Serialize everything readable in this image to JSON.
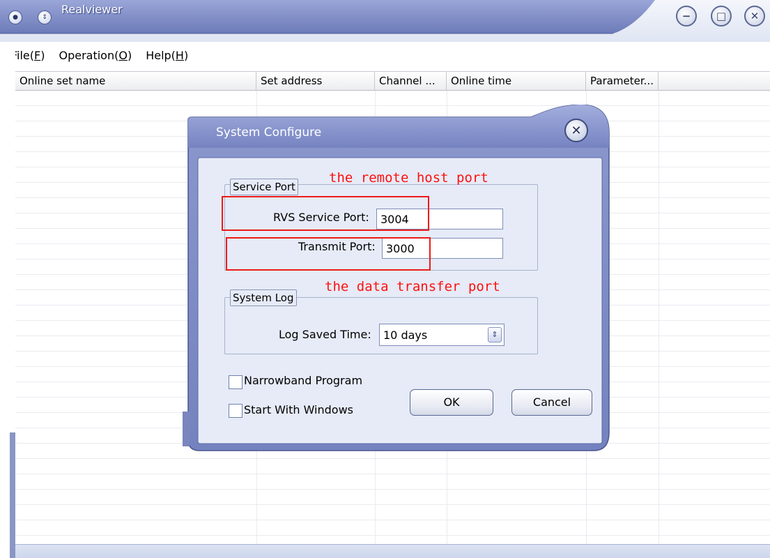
{
  "window": {
    "title": "Realviewer",
    "controls": {
      "minimize": "−",
      "maximize": "□",
      "close": "✕"
    }
  },
  "menu": [
    {
      "label": "File(",
      "key": "F",
      "suffix": ")"
    },
    {
      "label": "Operation(",
      "key": "O",
      "suffix": ")"
    },
    {
      "label": "Help(",
      "key": "H",
      "suffix": ")"
    }
  ],
  "list": {
    "columns": [
      "Online set name",
      "Set address",
      "Channel ...",
      "Online time",
      "Parameter..."
    ]
  },
  "dialog": {
    "title": "System Configure",
    "close": "✕",
    "service_port": {
      "label": "Service Port",
      "rvs_label": "RVS Service Port:",
      "rvs_value": "3004",
      "transmit_label": "Transmit Port:",
      "transmit_value": "3000"
    },
    "system_log": {
      "label": "System Log",
      "saved_time_label": "Log Saved Time:",
      "saved_time_value": "10 days"
    },
    "options": {
      "narrowband": "Narrowband Program",
      "start_with_windows": "Start With Windows"
    },
    "buttons": {
      "ok": "OK",
      "cancel": "Cancel"
    }
  },
  "annotations": {
    "remote_host": "the remote host port",
    "data_transfer": "the data transfer port"
  },
  "colors": {
    "title_blue": "#8390c6",
    "dialog_bg": "#e6ebf7",
    "annotation_red": "#ff1010"
  }
}
